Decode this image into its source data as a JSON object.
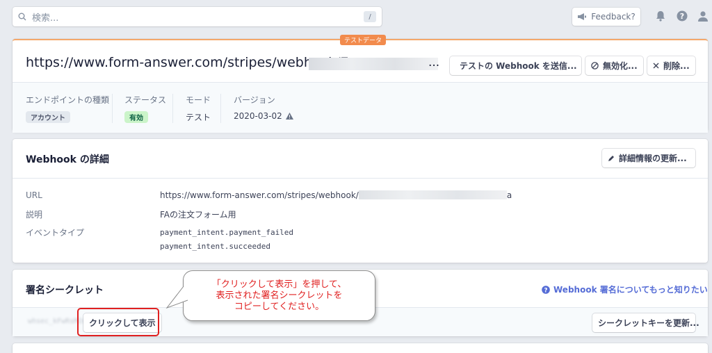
{
  "topbar": {
    "search_placeholder": "検索...",
    "search_shortcut": "/",
    "feedback_label": "Feedback?"
  },
  "header": {
    "badge": "テストデータ",
    "endpoint_url": "https://www.form-answer.com/stripes/webhook/7",
    "ellipsis": "...",
    "send_test_button": "テストの Webhook を送信...",
    "disable_button": "無効化...",
    "delete_button": "削除...",
    "meta": {
      "type_label": "エンドポイントの種類",
      "type_value": "アカウント",
      "status_label": "ステータス",
      "status_value": "有効",
      "mode_label": "モード",
      "mode_value": "テスト",
      "version_label": "バージョン",
      "version_value": "2020-03-02"
    }
  },
  "details": {
    "title": "Webhook の詳細",
    "update_button": "詳細情報の更新...",
    "url_label": "URL",
    "url_value": "https://www.form-answer.com/stripes/webhook/",
    "url_tail": "a",
    "description_label": "説明",
    "description_value": "FAの注文フォーム用",
    "event_type_label": "イベントタイプ",
    "events": [
      "payment_intent.payment_failed",
      "payment_intent.succeeded"
    ]
  },
  "secret": {
    "title": "署名シークレット",
    "learn_more_link": "Webhook 署名についてもっと知りたい",
    "reveal_button": "クリックして表示",
    "masked_secret": "whsec_kFwRsM2dqPkLzQbT9nVx",
    "rotate_button": "シークレットキーを更新..."
  },
  "callout": {
    "lines": [
      "「クリックして表示」を押して、",
      "表示された署名シークレットを",
      "コピーしてください。"
    ]
  },
  "colors": {
    "test_accent": "#f28b4d",
    "active_green": "#0e6245",
    "link_blue": "#556cd6",
    "annotation_red": "#e02020"
  }
}
